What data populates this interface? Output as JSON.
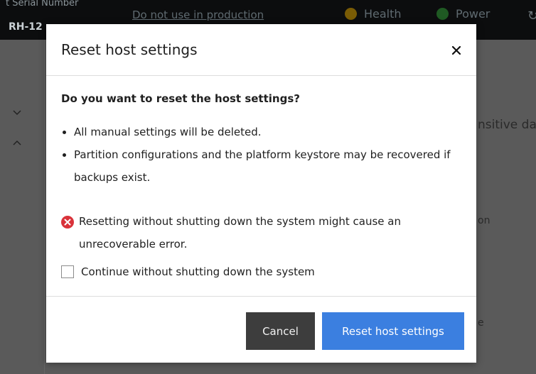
{
  "header": {
    "serial_label": "t Serial Number",
    "serial_value": "RH-12",
    "message": "Do not use in production",
    "health_label": "Health",
    "power_label": "Power"
  },
  "background": {
    "partial_text_1": "nsitive da",
    "partial_text_2": "on",
    "partial_text_3": "e"
  },
  "modal": {
    "title": "Reset host settings",
    "question": "Do you want to reset the host settings?",
    "bullets": [
      "All manual settings will be deleted.",
      "Partition configurations and the platform keystore may be recovered if backups exist."
    ],
    "error_text": "Resetting without shutting down the system might cause an unrecoverable error.",
    "checkbox_label": "Continue without shutting down the system",
    "checkbox_checked": false,
    "cancel_label": "Cancel",
    "confirm_label": "Reset host settings"
  },
  "colors": {
    "primary_button": "#3b7fe0",
    "secondary_button": "#3d3d3d",
    "error": "#d9323a",
    "health_status": "#f0b400",
    "power_status": "#2ea836"
  },
  "icons": {
    "close": "close-icon",
    "error": "error-icon",
    "health": "warning-status-icon",
    "power": "power-status-icon",
    "refresh": "refresh-icon",
    "nav_expand": "chevron-down-icon",
    "nav_collapse": "chevron-up-icon"
  }
}
